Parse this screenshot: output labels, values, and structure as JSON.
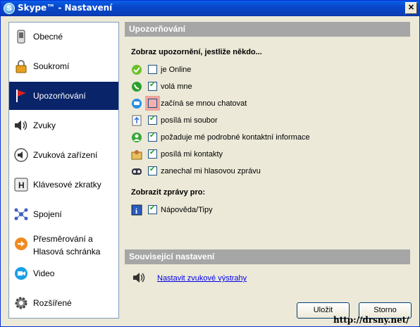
{
  "window": {
    "title": "Skype™ - Nastavení",
    "close_glyph": "✕"
  },
  "sidebar": {
    "items": [
      {
        "label": "Obecné",
        "icon": "phone-device-icon"
      },
      {
        "label": "Soukromí",
        "icon": "lock-icon"
      },
      {
        "label": "Upozorňování",
        "icon": "red-flag-icon",
        "selected": true
      },
      {
        "label": "Zvuky",
        "icon": "speaker-icon"
      },
      {
        "label": "Zvuková zařízení",
        "icon": "audio-device-icon"
      },
      {
        "label": "Klávesové zkratky",
        "icon": "keyboard-key-icon"
      },
      {
        "label": "Spojení",
        "icon": "network-icon"
      },
      {
        "label": "Přesměrování a\nHlasová schránka",
        "icon": "forward-voicemail-icon"
      },
      {
        "label": "Video",
        "icon": "video-camera-icon"
      },
      {
        "label": "Rozšířené",
        "icon": "gear-icon"
      }
    ]
  },
  "main": {
    "section_title": "Upozorňování",
    "notify_heading": "Zobraz upozornění, jestliže někdo...",
    "notify_items": [
      {
        "label": "je Online",
        "checked": false,
        "icon": "online-status-icon"
      },
      {
        "label": "volá mne",
        "checked": true,
        "icon": "call-icon"
      },
      {
        "label": "začíná se mnou chatovat",
        "checked": false,
        "highlighted": true,
        "icon": "chat-icon"
      },
      {
        "label": "posílá mi soubor",
        "checked": true,
        "icon": "file-transfer-icon"
      },
      {
        "label": "požaduje mé podrobné kontaktní informace",
        "checked": true,
        "icon": "contact-request-icon"
      },
      {
        "label": "posílá mi kontakty",
        "checked": true,
        "icon": "send-contacts-icon"
      },
      {
        "label": "zanechal mi hlasovou zprávu",
        "checked": true,
        "icon": "voicemail-icon"
      }
    ],
    "messages_heading": "Zobrazit zprávy pro:",
    "message_items": [
      {
        "label": "Nápověda/Tipy",
        "checked": true,
        "icon": "info-icon"
      }
    ],
    "related_title": "Související nastavení",
    "related_link": "Nastavit zvukové výstrahy",
    "save_label": "Uložit",
    "cancel_label": "Storno"
  },
  "watermark": "http://drsny.net/",
  "colors": {
    "selected_bg": "#0a246a",
    "section_header_bg": "#a6a6a6",
    "window_bg": "#ece9d8",
    "titlebar": "#0a5fe8"
  }
}
